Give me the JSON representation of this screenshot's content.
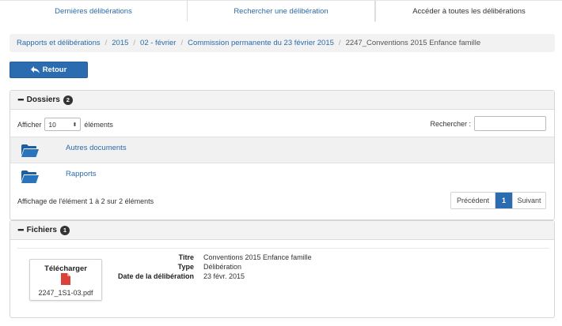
{
  "tabs": [
    {
      "label": "Dernières délibérations"
    },
    {
      "label": "Rechercher une délibération"
    },
    {
      "label": "Accéder à toutes les délibérations"
    }
  ],
  "breadcrumb": [
    {
      "label": "Rapports et délibérations"
    },
    {
      "label": "2015"
    },
    {
      "label": "02 - février"
    },
    {
      "label": "Commission permanente du 23 février 2015"
    },
    {
      "label": "2247_Conventions 2015 Enfance famille"
    }
  ],
  "back_button": {
    "label": "Retour"
  },
  "dossiers": {
    "title": "Dossiers",
    "count": "2",
    "show_prefix": "Afficher",
    "page_size": "10",
    "show_suffix": "éléments",
    "search_label": "Rechercher :",
    "search_value": "",
    "items": [
      {
        "label": "Autres documents"
      },
      {
        "label": "Rapports"
      }
    ],
    "info": "Affichage de l'élément 1 à 2 sur 2 éléments",
    "pager": {
      "prev": "Précédent",
      "current": "1",
      "next": "Suivant"
    }
  },
  "fichiers": {
    "title": "Fichiers",
    "count": "1",
    "file": {
      "download_label": "Télécharger",
      "filename": "2247_1S1-03.pdf",
      "icon": "pdf-file-icon"
    },
    "meta": {
      "titre_label": "Titre",
      "titre": "Conventions 2015 Enfance famille",
      "type_label": "Type",
      "type": "Délibération",
      "date_label": "Date de la délibération",
      "date": "23 févr. 2015"
    }
  },
  "colors": {
    "accent": "#2b6cb0",
    "link": "#2a6bab",
    "pdf": "#d9423b"
  }
}
